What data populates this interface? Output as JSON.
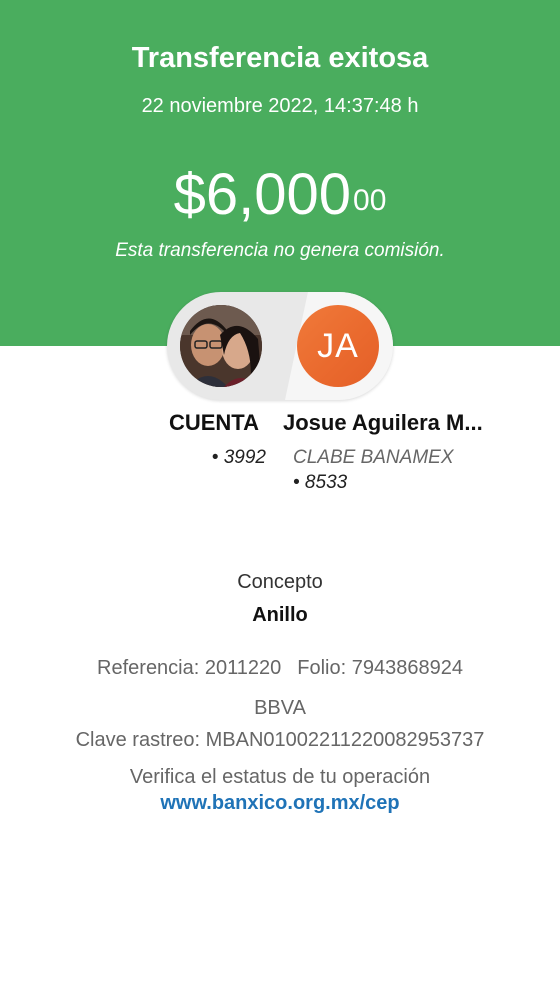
{
  "header": {
    "title": "Transferencia exitosa",
    "datetime": "22 noviembre 2022, 14:37:48 h",
    "amount_main": "$6,000",
    "amount_cents": "00",
    "fee_note": "Esta transferencia no genera comisión.",
    "background_color": "#4aad5e"
  },
  "transfer": {
    "from": {
      "name": "CUENTA",
      "account": "• 3992"
    },
    "to": {
      "name": "Josue Aguilera M...",
      "initials": "JA",
      "bank": "CLABE BANAMEX",
      "account": "• 8533",
      "avatar_color": "#ea6a2e"
    }
  },
  "details": {
    "concept_label": "Concepto",
    "concept_value": "Anillo",
    "reference": "Referencia: 2011220",
    "folio": "Folio: 7943868924",
    "bank": "BBVA",
    "tracking": "Clave rastreo: MBAN01002211220082953737",
    "verify_text": "Verifica el estatus de tu operación",
    "verify_link": "www.banxico.org.mx/cep",
    "link_color": "#1f73b7"
  }
}
